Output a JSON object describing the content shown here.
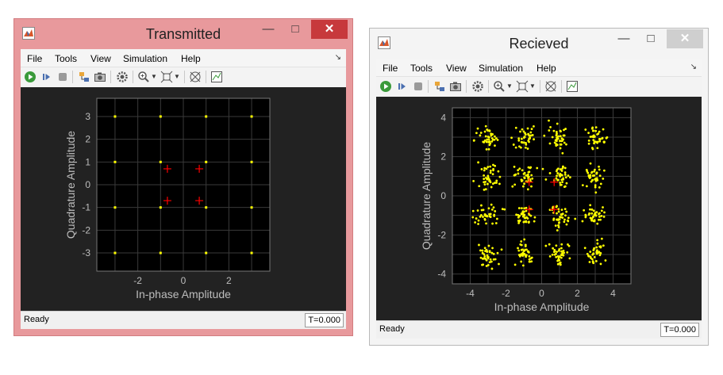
{
  "windows": [
    {
      "title": "Transmitted",
      "menu": [
        "File",
        "Tools",
        "View",
        "Simulation",
        "Help"
      ],
      "status": "Ready",
      "time": "T=0.000",
      "plot": {
        "xlabel": "In-phase Amplitude",
        "ylabel": "Quadrature Amplitude",
        "xlim": [
          -3.8,
          3.8
        ],
        "ylim": [
          -3.8,
          3.8
        ],
        "xticks": [
          -2,
          0,
          2
        ],
        "yticks": [
          -3,
          -2,
          -1,
          0,
          1,
          2,
          3
        ],
        "grid": true
      }
    },
    {
      "title": "Recieved",
      "menu": [
        "File",
        "Tools",
        "View",
        "Simulation",
        "Help"
      ],
      "status": "Ready",
      "time": "T=0.000",
      "plot": {
        "xlabel": "In-phase Amplitude",
        "ylabel": "Quadrature Amplitude",
        "xlim": [
          -5,
          5
        ],
        "ylim": [
          -4.5,
          4.5
        ],
        "xticks": [
          -4,
          -2,
          0,
          2,
          4
        ],
        "yticks": [
          -4,
          -2,
          0,
          2,
          4
        ],
        "grid": true
      }
    }
  ],
  "chart_data": [
    {
      "type": "scatter",
      "series_color": "#ffff00",
      "reference_color": "#ff0000",
      "xlabel": "In-phase Amplitude",
      "ylabel": "Quadrature Amplitude",
      "xlim": [
        -3.8,
        3.8
      ],
      "ylim": [
        -3.8,
        3.8
      ],
      "points": [
        [
          -3,
          3
        ],
        [
          -1,
          3
        ],
        [
          1,
          3
        ],
        [
          3,
          3
        ],
        [
          -3,
          1
        ],
        [
          -1,
          1
        ],
        [
          1,
          1
        ],
        [
          3,
          1
        ],
        [
          -3,
          -1
        ],
        [
          -1,
          -1
        ],
        [
          1,
          -1
        ],
        [
          3,
          -1
        ],
        [
          -3,
          -3
        ],
        [
          -1,
          -3
        ],
        [
          1,
          -3
        ],
        [
          3,
          -3
        ]
      ],
      "reference": [
        [
          -0.7,
          0.7
        ],
        [
          0.7,
          0.7
        ],
        [
          -0.7,
          -0.7
        ],
        [
          0.7,
          -0.7
        ]
      ]
    },
    {
      "type": "scatter",
      "series_color": "#ffff00",
      "reference_color": "#ff0000",
      "xlabel": "In-phase Amplitude",
      "ylabel": "Quadrature Amplitude",
      "xlim": [
        -5,
        5
      ],
      "ylim": [
        -4.5,
        4.5
      ],
      "cluster_centers": [
        [
          -3,
          3
        ],
        [
          -1,
          3
        ],
        [
          1,
          3
        ],
        [
          3,
          3
        ],
        [
          -3,
          1
        ],
        [
          -1,
          1
        ],
        [
          1,
          1
        ],
        [
          3,
          1
        ],
        [
          -3,
          -1
        ],
        [
          -1,
          -1
        ],
        [
          1,
          -1
        ],
        [
          3,
          -1
        ],
        [
          -3,
          -3
        ],
        [
          -1,
          -3
        ],
        [
          1,
          -3
        ],
        [
          3,
          -3
        ]
      ],
      "noise_std": 0.3,
      "points_per_cluster": 40,
      "reference": [
        [
          -0.7,
          0.7
        ],
        [
          0.7,
          0.7
        ],
        [
          -0.7,
          -0.7
        ],
        [
          0.7,
          -0.7
        ]
      ]
    }
  ]
}
